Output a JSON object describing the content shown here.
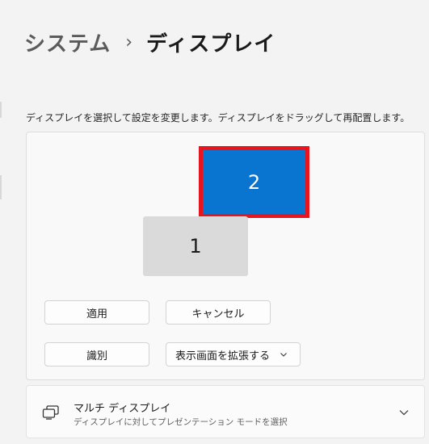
{
  "breadcrumb": {
    "parent": "システム",
    "separator": "›",
    "current": "ディスプレイ"
  },
  "instruction": "ディスプレイを選択して設定を変更します。ディスプレイをドラッグして再配置します。",
  "monitors": [
    {
      "label": "1",
      "selected": false
    },
    {
      "label": "2",
      "selected": true
    }
  ],
  "buttons": {
    "apply": "適用",
    "cancel": "キャンセル",
    "identify": "識別"
  },
  "dropdown": {
    "selected": "表示画面を拡張する",
    "icon": "chevron-down-icon"
  },
  "multi_display": {
    "title": "マルチ ディスプレイ",
    "subtitle": "ディスプレイに対してプレゼンテーション モードを選択",
    "icon": "multi-monitor-icon",
    "expand_icon": "chevron-down-icon"
  },
  "colors": {
    "selected_monitor": "#0a74d1",
    "selection_outline": "#e8151e",
    "unselected_monitor": "#dadada",
    "background": "#f3f3f3"
  }
}
